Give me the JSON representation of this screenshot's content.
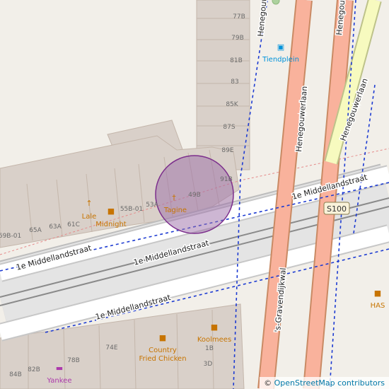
{
  "map": {
    "colors": {
      "background": "#f2efe9",
      "building": "#d9d0c9",
      "building_outline": "#c4b6ab",
      "trunk_road": "#f9b29c",
      "primary_road": "#fcd6a4",
      "secondary_road": "#f7fabf",
      "residential_road": "#ffffff",
      "tram_rail": "#777777",
      "bus_route": "#1e3cd2",
      "marker_fill": "#9c6ea8",
      "poi_food": "#c77400",
      "poi_brown": "#734a08",
      "poi_transport": "#0092da",
      "poi_shop": "#ac39ac",
      "tree": "#add19e"
    },
    "house_numbers": [
      "77B",
      "79B",
      "81B",
      "83",
      "85K",
      "87S",
      "89E",
      "91B",
      "49B",
      "53A",
      "55B-01",
      "61C",
      "63A",
      "65A",
      "69B-01",
      "74E",
      "78B",
      "82B",
      "84B",
      "1B",
      "3D"
    ],
    "pois": [
      {
        "name": "Tagine",
        "icon": "restaurant-icon",
        "color": "#c77400"
      },
      {
        "name": "Lale",
        "icon": "bar-icon",
        "color": "#c77400"
      },
      {
        "name": "Midnight",
        "icon": "fast-food-icon",
        "color": "#c77400"
      },
      {
        "name": "Country Fried Chicken",
        "line1": "Country",
        "line2": "Fried Chicken",
        "icon": "fast-food-icon",
        "color": "#c77400"
      },
      {
        "name": "Koolmees",
        "icon": "fast-food-icon",
        "color": "#c77400"
      },
      {
        "name": "HAS",
        "icon": "fast-food-icon",
        "color": "#c77400"
      },
      {
        "name": "Yankee",
        "icon": "smoking-shop-icon",
        "color": "#ac39ac"
      },
      {
        "name": "Tiendplein",
        "icon": "bus-stop-icon",
        "color": "#0092da"
      }
    ],
    "streets": [
      "Henegouwerlaan",
      "Henegouwerlaan",
      "Henegouwerlaan",
      "Henegouwerlaan",
      "1e Middellandstraat",
      "1e Middellandstraat",
      "1e Middellandstraat",
      "1e Middellandstraat",
      "'s-Gravendijkwal"
    ],
    "road_shield": "S100",
    "attribution": {
      "symbol": "©",
      "text": "OpenStreetMap contributors"
    }
  }
}
